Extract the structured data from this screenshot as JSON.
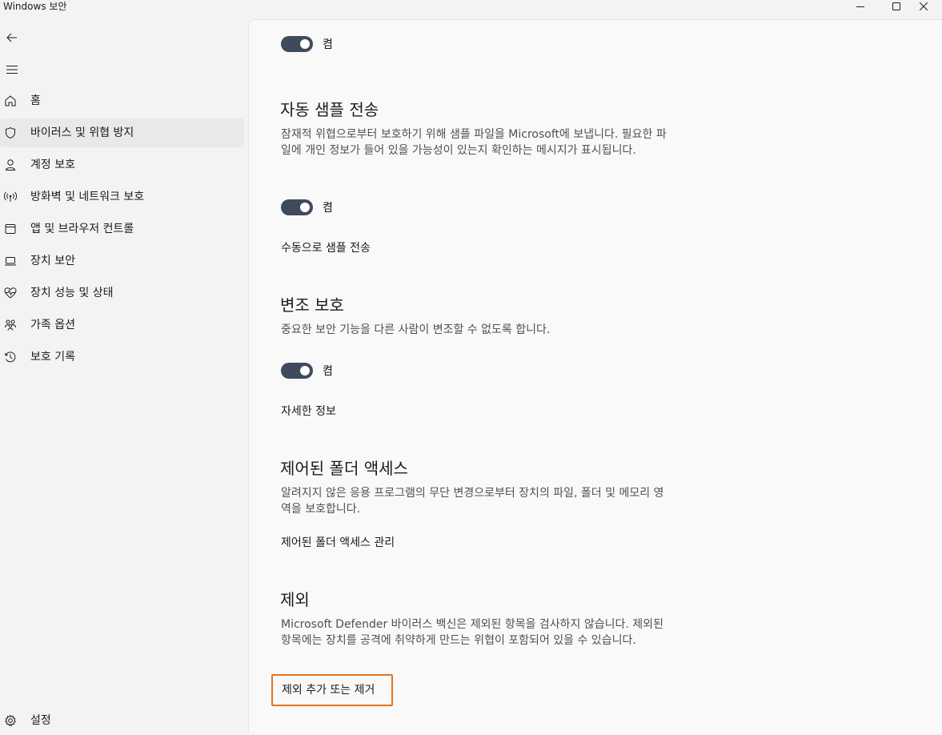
{
  "window": {
    "title": "Windows 보안",
    "minimize_icon": "minimize-icon",
    "maximize_icon": "maximize-icon",
    "close_icon": "close-icon"
  },
  "nav": {
    "back_icon": "back-arrow-icon",
    "menu_icon": "hamburger-menu-icon",
    "items": [
      {
        "label": "홈",
        "icon": "home-icon"
      },
      {
        "label": "바이러스 및 위협 방지",
        "icon": "shield-icon",
        "active": true
      },
      {
        "label": "계정 보호",
        "icon": "person-icon"
      },
      {
        "label": "방화벽 및 네트워크 보호",
        "icon": "wireless-antenna-icon"
      },
      {
        "label": "앱 및 브라우저 컨트롤",
        "icon": "browser-window-icon"
      },
      {
        "label": "장치 보안",
        "icon": "laptop-icon"
      },
      {
        "label": "장치 성능 및 상태",
        "icon": "heart-pulse-icon"
      },
      {
        "label": "가족 옵션",
        "icon": "family-icon"
      },
      {
        "label": "보호 기록",
        "icon": "history-icon"
      }
    ],
    "settings": {
      "label": "설정",
      "icon": "gear-icon"
    }
  },
  "main": {
    "top_toggle": {
      "state_label": "켬",
      "on": true
    },
    "sample_submission": {
      "heading": "자동 샘플 전송",
      "description": "잠재적 위협으로부터 보호하기 위해 샘플 파일을 Microsoft에 보냅니다. 필요한 파일에 개인 정보가 들어 있을 가능성이 있는지 확인하는 메시지가 표시됩니다.",
      "toggle": {
        "state_label": "켬",
        "on": true
      },
      "link": "수동으로 샘플 전송"
    },
    "tamper_protection": {
      "heading": "변조 보호",
      "description": "중요한 보안 기능을 다른 사람이 변조할 수 없도록 합니다.",
      "toggle": {
        "state_label": "켬",
        "on": true
      },
      "link": "자세한 정보"
    },
    "controlled_folder_access": {
      "heading": "제어된 폴더 액세스",
      "description": "알려지지 않은 응용 프로그램의 무단 변경으로부터 장치의 파일, 폴더 및 메모리 영역을 보호합니다.",
      "link": "제어된 폴더 액세스 관리"
    },
    "exclusions": {
      "heading": "제외",
      "description": "Microsoft Defender 바이러스 백신은 제외된 항목을 검사하지 않습니다. 제외된 항목에는 장치를 공격에 취약하게 만드는 위협이 포함되어 있을 수 있습니다.",
      "link": "제외 추가 또는 제거"
    }
  },
  "colors": {
    "toggle_on": "#3f4b5c",
    "focus_outline": "#e8731a",
    "nav_active_bg": "#e9e9e9"
  }
}
